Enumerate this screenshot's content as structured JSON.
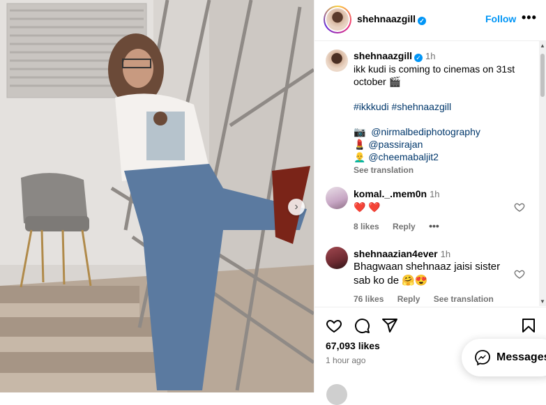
{
  "post": {
    "author": "shehnaazgill",
    "follow_label": "Follow",
    "more_label": "•••",
    "next_label": "›"
  },
  "caption": {
    "username": "shehnaazgill",
    "time": "1h",
    "line1": "ikk kudi is coming to cinemas on 31st october 🎬",
    "hashtags": "#ikkkudi #shehnaazgill",
    "credits": [
      {
        "emoji": "📷",
        "handle": "@nirmalbediphotography"
      },
      {
        "emoji": "💄",
        "handle": "@passirajan"
      },
      {
        "emoji": "👨‍🦲",
        "handle": "@cheemabaljit2"
      }
    ],
    "see_translation": "See translation"
  },
  "comments": [
    {
      "username": "komal._.mem0n",
      "time": "1h",
      "text": "❤️ ❤️",
      "likes": "8 likes",
      "reply": "Reply",
      "more": "•••"
    },
    {
      "username": "shehnaazian4ever",
      "time": "1h",
      "text": "Bhagwaan shehnaaz jaisi sister sab ko de 🤗😍",
      "likes": "76 likes",
      "reply": "Reply",
      "translation": "See translation"
    }
  ],
  "footer": {
    "likes": "67,093 likes",
    "ago": "1 hour ago"
  },
  "messages": {
    "label": "Messages"
  },
  "colors": {
    "accent": "#0095f6",
    "link": "#00376b",
    "muted": "#737373",
    "heart": "#ed4956"
  },
  "icons": [
    "verified-badge-icon",
    "heart-icon",
    "comment-icon",
    "share-icon",
    "bookmark-icon",
    "messenger-icon",
    "chevron-right-icon"
  ]
}
